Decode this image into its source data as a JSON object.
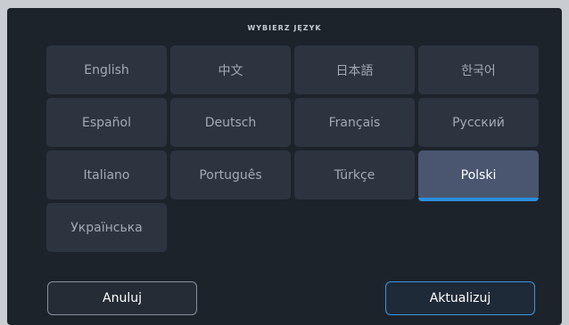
{
  "dialog": {
    "title": "WYBIERZ JĘZYK"
  },
  "languages": [
    {
      "label": "English",
      "selected": false
    },
    {
      "label": "中文",
      "selected": false
    },
    {
      "label": "日本語",
      "selected": false
    },
    {
      "label": "한국어",
      "selected": false
    },
    {
      "label": "Español",
      "selected": false
    },
    {
      "label": "Deutsch",
      "selected": false
    },
    {
      "label": "Français",
      "selected": false
    },
    {
      "label": "Русский",
      "selected": false
    },
    {
      "label": "Italiano",
      "selected": false
    },
    {
      "label": "Português",
      "selected": false
    },
    {
      "label": "Türkçe",
      "selected": false
    },
    {
      "label": "Polski",
      "selected": true
    },
    {
      "label": "Українська",
      "selected": false
    }
  ],
  "actions": {
    "cancel_label": "Anuluj",
    "update_label": "Aktualizuj"
  },
  "colors": {
    "accent": "#2c8fdc",
    "selected_tile": "#4a5670",
    "tile": "#2c3440",
    "panel": "#1d232b"
  }
}
